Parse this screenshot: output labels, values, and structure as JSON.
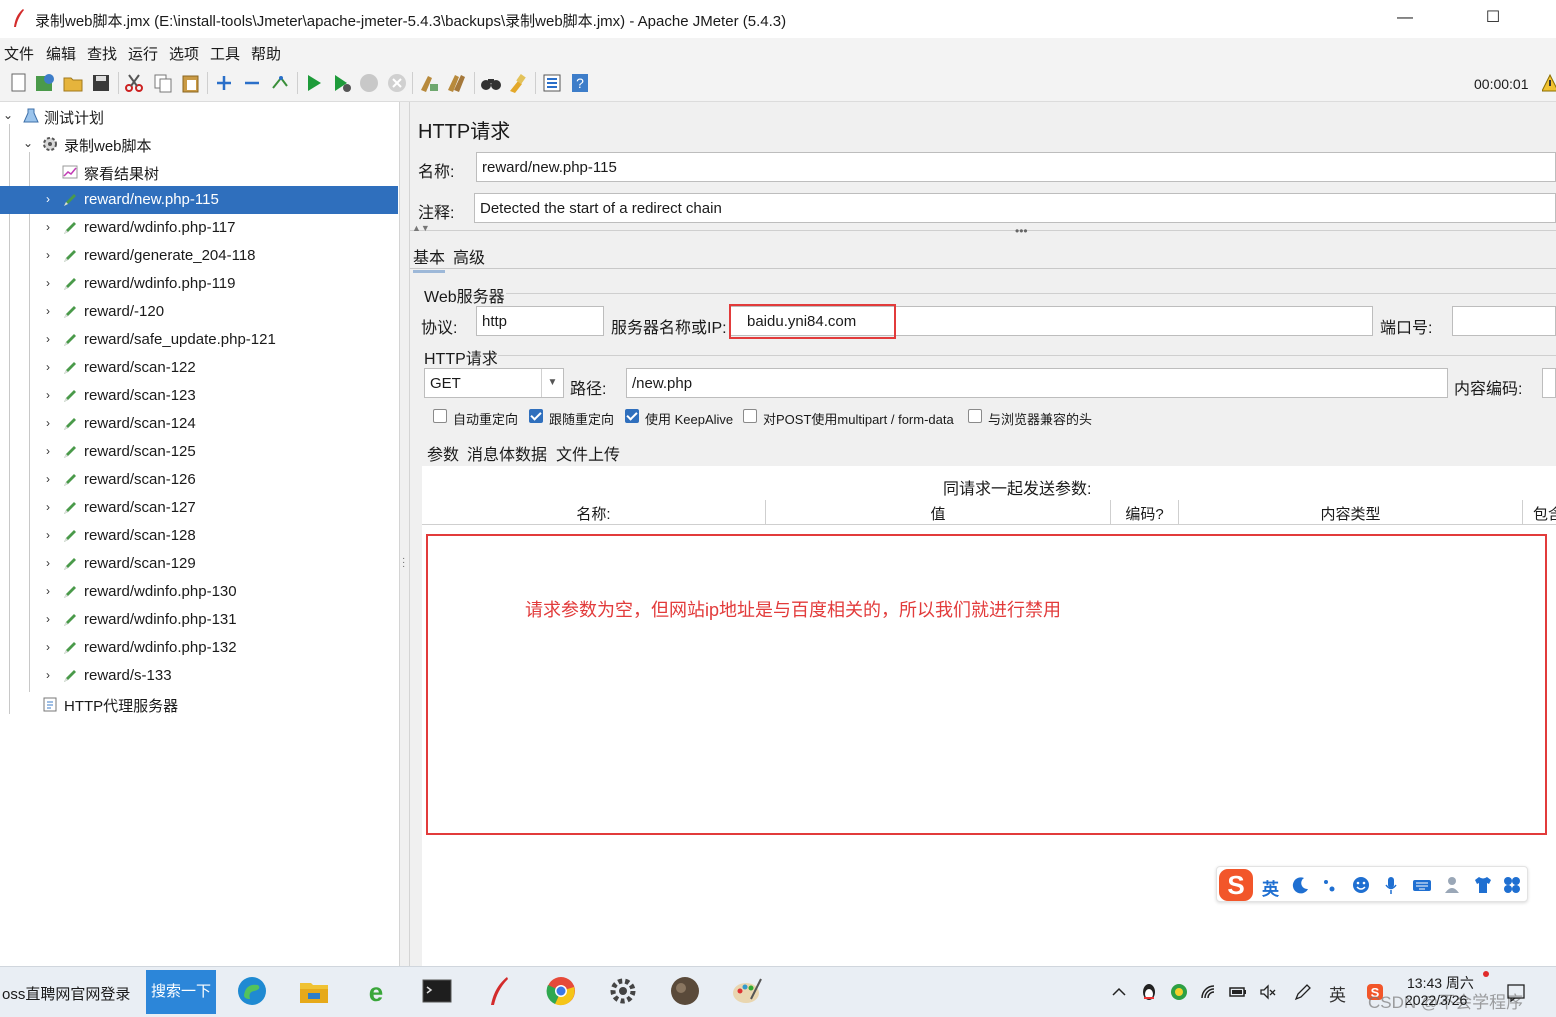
{
  "window": {
    "title": "录制web脚本.jmx (E:\\install-tools\\Jmeter\\apache-jmeter-5.4.3\\backups\\录制web脚本.jmx) - Apache JMeter (5.4.3)",
    "minimize": "—",
    "maximize": "☐"
  },
  "menu": [
    "文件",
    "编辑",
    "查找",
    "运行",
    "选项",
    "工具",
    "帮助"
  ],
  "toolbar": {
    "elapsed": "00:00:01",
    "icons": [
      "new-icon",
      "templates-icon",
      "open-icon",
      "save-icon",
      "cut-icon",
      "copy-icon",
      "paste-icon",
      "expand-icon",
      "collapse-icon",
      "toggle-icon",
      "start-icon",
      "start-no-pause-icon",
      "stop-icon",
      "shutdown-icon",
      "clear-icon",
      "clear-all-icon",
      "search-icon",
      "reset-search-icon",
      "function-helper-icon",
      "help-icon"
    ]
  },
  "tree": {
    "test_plan": "测试计划",
    "thread_group": "录制web脚本",
    "listener": "察看结果树",
    "samplers": [
      "reward/new.php-115",
      "reward/wdinfo.php-117",
      "reward/generate_204-118",
      "reward/wdinfo.php-119",
      "reward/-120",
      "reward/safe_update.php-121",
      "reward/scan-122",
      "reward/scan-123",
      "reward/scan-124",
      "reward/scan-125",
      "reward/scan-126",
      "reward/scan-127",
      "reward/scan-128",
      "reward/scan-129",
      "reward/wdinfo.php-130",
      "reward/wdinfo.php-131",
      "reward/wdinfo.php-132",
      "reward/s-133"
    ],
    "proxy": "HTTP代理服务器",
    "selected_index": 0
  },
  "panel": {
    "title": "HTTP请求",
    "name_label": "名称:",
    "name_value": "reward/new.php-115",
    "comment_label": "注释:",
    "comment_value": "Detected the start of a redirect chain",
    "tabs": [
      "基本",
      "高级"
    ],
    "web_server_group": "Web服务器",
    "protocol_label": "协议:",
    "protocol_value": "http",
    "server_label": "服务器名称或IP:",
    "server_value": "baidu.yni84.com",
    "port_label": "端口号:",
    "port_value": "",
    "http_request_group": "HTTP请求",
    "method": "GET",
    "path_label": "路径:",
    "path_value": "/new.php",
    "encoding_label": "内容编码:",
    "checkboxes": [
      {
        "label": "自动重定向",
        "checked": false
      },
      {
        "label": "跟随重定向",
        "checked": true
      },
      {
        "label": "使用 KeepAlive",
        "checked": true
      },
      {
        "label": "对POST使用multipart / form-data",
        "checked": false
      },
      {
        "label": "与浏览器兼容的头",
        "checked": false
      }
    ],
    "sub_tabs": [
      "参数",
      "消息体数据",
      "文件上传"
    ],
    "params_caption": "同请求一起发送参数:",
    "columns": [
      "名称:",
      "值",
      "编码?",
      "内容类型",
      "包含"
    ],
    "annotation": "请求参数为空，但网站ip地址是与百度相关的，所以我们就进行禁用"
  },
  "ime": {
    "lang": "英",
    "icons": [
      "sogou-logo-icon",
      "moon-icon",
      "punctuation-icon",
      "emoji-icon",
      "microphone-icon",
      "keyboard-icon",
      "user-icon",
      "shirt-icon",
      "apps-icon"
    ]
  },
  "taskbar": {
    "search_text": "oss直聘网官网登录",
    "search_button": "搜索一下",
    "apps": [
      "edge-icon",
      "file-explorer-icon",
      "ie-icon",
      "terminal-icon",
      "jmeter-icon",
      "chrome-icon",
      "settings-icon",
      "photo-icon",
      "paint-icon"
    ],
    "tray": [
      "chevron-up-icon",
      "qq-icon",
      "wechat-icon",
      "wifi-icon",
      "battery-icon",
      "volume-mute-icon",
      "pen-icon"
    ],
    "input_indicator": "英",
    "time": "13:43 周六",
    "date": "2022/3/26",
    "watermark": "CSDN @不会学程序"
  },
  "colors": {
    "selection": "#2f6fbd",
    "annotation_red": "#e23b3b",
    "search_button": "#2c86d9"
  }
}
